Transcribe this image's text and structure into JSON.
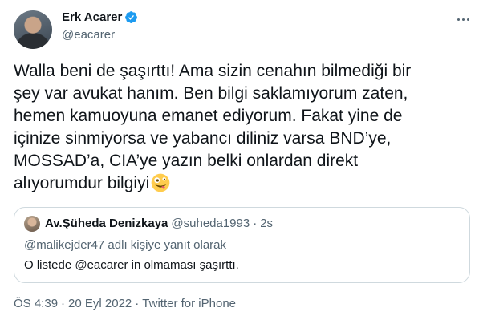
{
  "author": {
    "name": "Erk Acarer",
    "handle": "@eacarer",
    "verified_color": "#1d9bf0"
  },
  "tweet": {
    "text": "Walla beni de şaşırttı! Ama sizin cenahın bilmediği bir\nşey var avukat hanım. Ben bilgi saklamıyorum zaten,\nhemen kamuoyuna emanet ediyorum. Fakat yine de\niçinize sinmiyorsa ve yabancı diliniz varsa BND’ye,\nMOSSAD’a, CIA’ye yazın belki onlardan direkt\nalıyorumdur bilgiyi",
    "emoji": "zany-face-emoji"
  },
  "quote": {
    "name": "Av.Şüheda Denizkaya",
    "handle": "@suheda1993",
    "separator": "·",
    "time": "2s",
    "reply_context": "@malikejder47 adlı kişiye yanıt olarak",
    "text": "O listede @eacarer in olmaması şaşırttı."
  },
  "meta": {
    "time": "ÖS 4:39",
    "sep1": "·",
    "date": "20 Eyl 2022",
    "sep2": "·",
    "source": "Twitter for iPhone"
  },
  "colors": {
    "text_primary": "#0f1419",
    "text_secondary": "#536471",
    "border": "#cfd9de"
  }
}
